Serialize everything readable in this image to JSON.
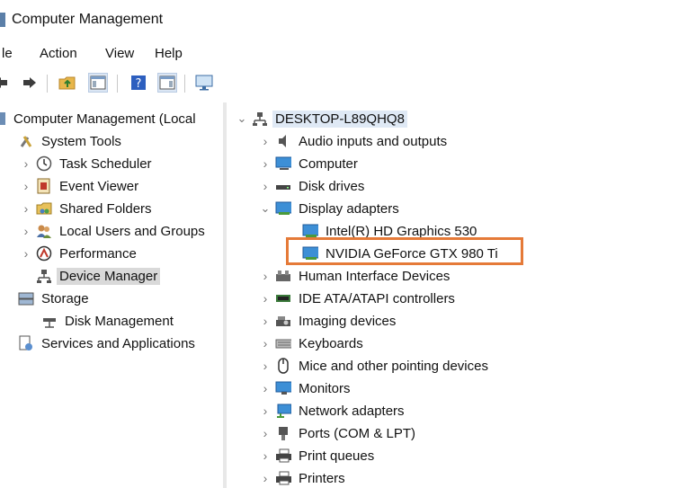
{
  "window": {
    "title": "Computer Management"
  },
  "menu": [
    "le",
    "Action",
    "View",
    "Help"
  ],
  "toolbar": {
    "icons": [
      "back-arrow-icon",
      "forward-arrow-icon",
      "up-folder-icon",
      "show-hide-console-tree-icon",
      "help-icon",
      "show-hide-action-pane-icon",
      "monitor-icon"
    ]
  },
  "left_tree": {
    "root": "Computer Management (Local",
    "system_tools": "System Tools",
    "task_scheduler": "Task Scheduler",
    "event_viewer": "Event Viewer",
    "shared_folders": "Shared Folders",
    "local_users": "Local Users and Groups",
    "performance": "Performance",
    "device_manager": "Device Manager",
    "storage": "Storage",
    "disk_management": "Disk Management",
    "services": "Services and Applications"
  },
  "device_tree": {
    "computer_name": "DESKTOP-L89QHQ8",
    "categories": [
      "Audio inputs and outputs",
      "Computer",
      "Disk drives",
      "Display adapters",
      "Intel(R) HD Graphics 530",
      "NVIDIA GeForce GTX 980 Ti",
      "Human Interface Devices",
      "IDE ATA/ATAPI controllers",
      "Imaging devices",
      "Keyboards",
      "Mice and other pointing devices",
      "Monitors",
      "Network adapters",
      "Ports (COM & LPT)",
      "Print queues",
      "Printers"
    ]
  },
  "colors": {
    "highlight_border": "#e57a38",
    "selection": "#d9d9d9"
  }
}
